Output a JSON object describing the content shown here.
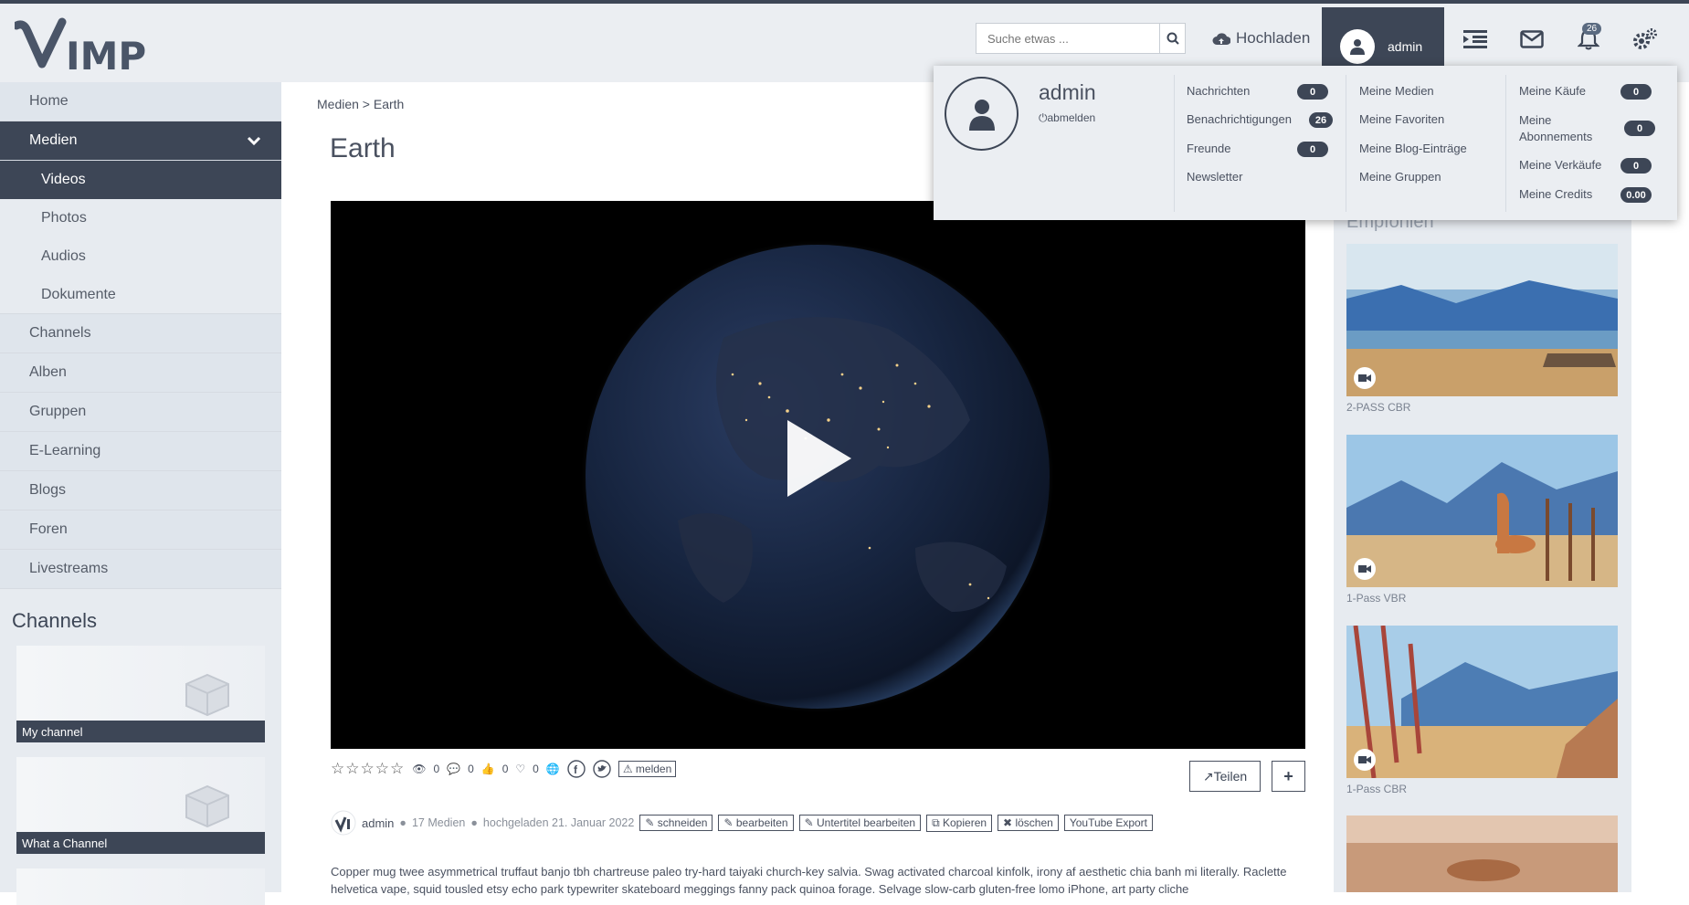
{
  "brand": {
    "logo_text": "VIMP"
  },
  "header": {
    "search_placeholder": "Suche etwas ...",
    "upload_label": "Hochladen",
    "user_label": "admin",
    "notification_count": "26"
  },
  "sidebar": {
    "items": [
      {
        "label": "Home"
      },
      {
        "label": "Medien"
      },
      {
        "label": "Videos"
      },
      {
        "label": "Photos"
      },
      {
        "label": "Audios"
      },
      {
        "label": "Dokumente"
      },
      {
        "label": "Channels"
      },
      {
        "label": "Alben"
      },
      {
        "label": "Gruppen"
      },
      {
        "label": "E-Learning"
      },
      {
        "label": "Blogs"
      },
      {
        "label": "Foren"
      },
      {
        "label": "Livestreams"
      }
    ],
    "channels_heading": "Channels",
    "channels": [
      {
        "name": "My channel"
      },
      {
        "name": "What a Channel"
      }
    ]
  },
  "main": {
    "breadcrumb": "Medien > Earth",
    "title": "Earth",
    "stats": {
      "views": "0",
      "comments": "0",
      "likes": "0",
      "favorites": "0"
    },
    "report_label": "melden",
    "share_label": "Teilen",
    "add_label": "+",
    "author": "admin",
    "media_count": "17 Medien",
    "uploaded": "hochgeladen 21. Januar 2022",
    "actions": [
      "schneiden",
      "bearbeiten",
      "Untertitel bearbeiten",
      "Kopieren",
      "löschen",
      "YouTube Export"
    ],
    "description": "Copper mug twee asymmetrical truffaut banjo tbh chartreuse paleo try-hard taiyaki church-key salvia. Swag activated charcoal kinfolk, irony af aesthetic chia banh mi literally. Raclette helvetica vape, squid tousled etsy echo park typewriter skateboard meggings fanny pack quinoa forage. Selvage slow-carb gluten-free lomo iPhone, art party cliche"
  },
  "recommended": {
    "heading": "Empfohlen",
    "items": [
      {
        "caption": "2-PASS CBR"
      },
      {
        "caption": "1-Pass VBR"
      },
      {
        "caption": "1-Pass CBR"
      }
    ]
  },
  "user_menu": {
    "name": "admin",
    "logout_label": "abmelden",
    "col1": [
      {
        "label": "Nachrichten",
        "badge": "0"
      },
      {
        "label": "Benachrichtigungen",
        "badge": "26"
      },
      {
        "label": "Freunde",
        "badge": "0"
      },
      {
        "label": "Newsletter"
      }
    ],
    "col2": [
      {
        "label": "Meine Medien"
      },
      {
        "label": "Meine Favoriten"
      },
      {
        "label": "Meine Blog-Einträge"
      },
      {
        "label": "Meine Gruppen"
      }
    ],
    "col3": [
      {
        "label": "Meine Käufe",
        "badge": "0"
      },
      {
        "label": "Meine Abonnements",
        "badge": "0"
      },
      {
        "label": "Meine Verkäufe",
        "badge": "0"
      },
      {
        "label": "Meine Credits",
        "badge": "0.00"
      }
    ]
  },
  "colors": {
    "primary": "#3d4656",
    "sidebar_bg": "#e7ebf0",
    "topbar_bg": "#ebeef2"
  }
}
